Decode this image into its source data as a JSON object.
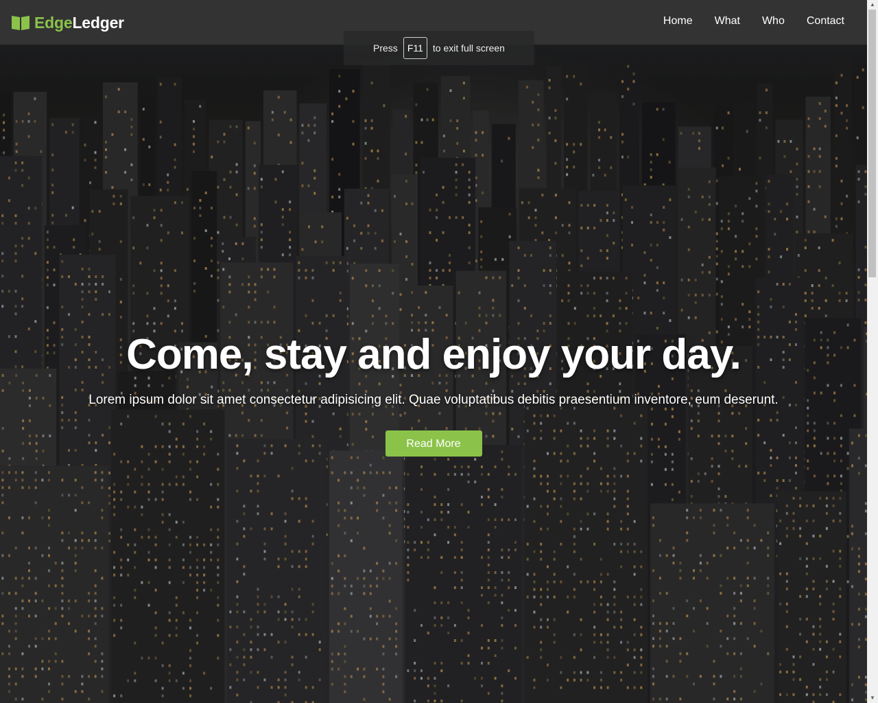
{
  "header": {
    "logo_part1": "Edge",
    "logo_part2": "Ledger",
    "logo_icon": "open-book-icon",
    "nav": [
      {
        "label": "Home"
      },
      {
        "label": "What"
      },
      {
        "label": "Who"
      },
      {
        "label": "Contact"
      }
    ]
  },
  "toast": {
    "prefix": "Press",
    "key": "F11",
    "suffix": "to exit full screen"
  },
  "hero": {
    "title": "Come, stay and enjoy your day.",
    "subtitle": "Lorem ipsum dolor sit amet consectetur adipisicing elit. Quae voluptatibus debitis praesentium inventore, eum deserunt.",
    "cta_label": "Read More"
  },
  "colors": {
    "accent": "#8bc34a",
    "header_bg": "#333333"
  }
}
